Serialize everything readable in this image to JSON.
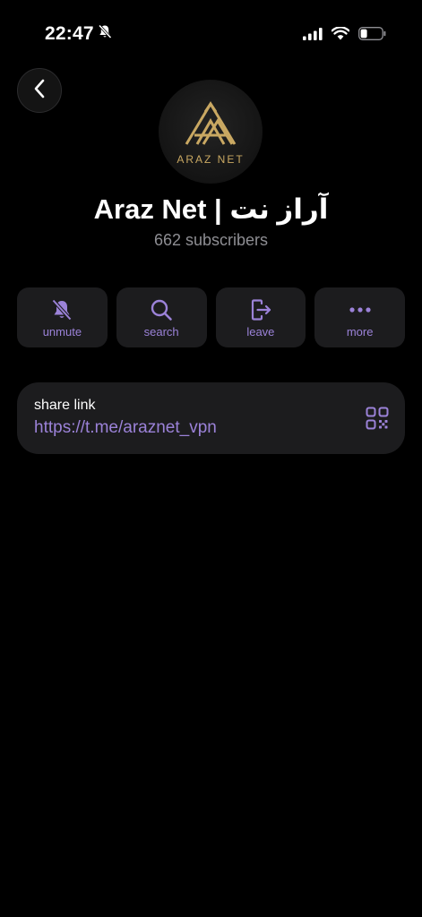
{
  "status_bar": {
    "time": "22:47",
    "icons": [
      "bell-slash-icon",
      "cellular-signal-icon",
      "wifi-icon",
      "battery-icon"
    ],
    "battery_level": 0.25
  },
  "header": {
    "back_icon": "chevron-left-icon"
  },
  "channel": {
    "avatar_logo_text": "ARAZ NET",
    "name": "Araz Net | آراز نت",
    "subscribers": "662 subscribers"
  },
  "actions": [
    {
      "label": "unmute",
      "icon": "bell-slash-icon"
    },
    {
      "label": "search",
      "icon": "search-icon"
    },
    {
      "label": "leave",
      "icon": "leave-icon"
    },
    {
      "label": "more",
      "icon": "ellipsis-icon"
    }
  ],
  "share": {
    "title": "share link",
    "url": "https://t.me/araznet_vpn",
    "icon": "qr-code-icon"
  },
  "colors": {
    "background": "#000000",
    "card": "#1c1c1e",
    "accent": "#9b82d8",
    "secondary_text": "#8e8e93",
    "logo_gold": "#c9a862"
  }
}
